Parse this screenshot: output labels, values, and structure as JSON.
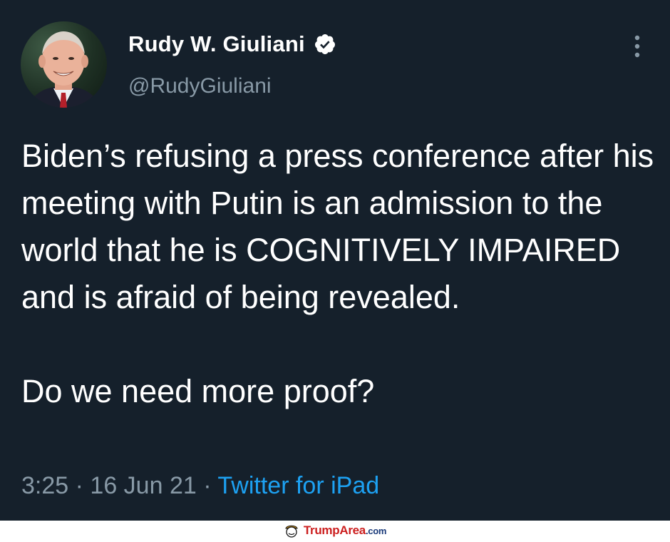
{
  "tweet": {
    "display_name": "Rudy W. Giuliani",
    "handle": "@RudyGiuliani",
    "verified": true,
    "text_paragraphs": [
      "Biden’s refusing a press conference after his meeting with Putin is an admission to the world that he is COGNITIVELY IMPAIRED and is afraid of being revealed.",
      "Do we need more proof?"
    ],
    "time": "3:25",
    "separator": "·",
    "date": "16 Jun 21",
    "source": "Twitter for iPad"
  },
  "watermark": {
    "brand": "TrumpArea",
    "domain": ".com"
  },
  "colors": {
    "background": "#15202b",
    "primary_text": "#ffffff",
    "secondary_text": "#8899a6",
    "accent": "#1da1f2",
    "watermark_red": "#cc1f1f",
    "watermark_blue": "#1a3a7a"
  },
  "icons": {
    "verified": "verified-badge-icon",
    "more": "more-vertical-icon",
    "watermark": "trump-logo-icon"
  }
}
